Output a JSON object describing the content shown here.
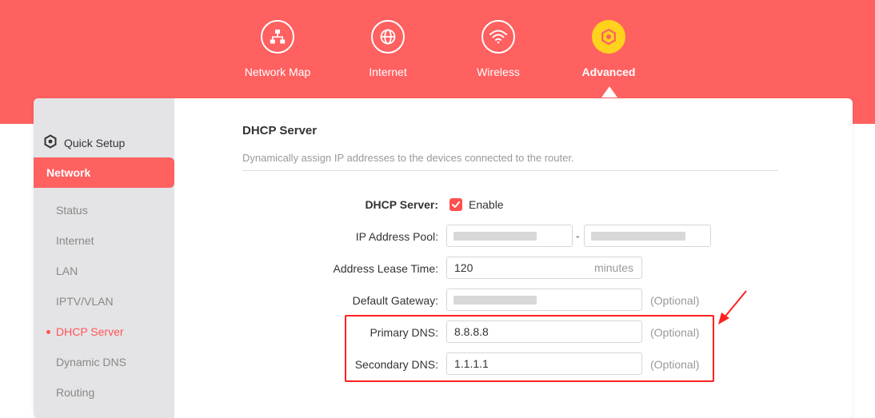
{
  "nav": {
    "items": [
      {
        "label": "Network Map",
        "icon": "network-map-icon"
      },
      {
        "label": "Internet",
        "icon": "globe-icon"
      },
      {
        "label": "Wireless",
        "icon": "wifi-icon"
      },
      {
        "label": "Advanced",
        "icon": "gear-icon",
        "active": true
      }
    ]
  },
  "sidebar": {
    "quick_setup": "Quick Setup",
    "section": "Network",
    "items": [
      {
        "label": "Status"
      },
      {
        "label": "Internet"
      },
      {
        "label": "LAN"
      },
      {
        "label": "IPTV/VLAN"
      },
      {
        "label": "DHCP Server",
        "active": true
      },
      {
        "label": "Dynamic DNS"
      },
      {
        "label": "Routing"
      }
    ]
  },
  "content": {
    "title": "DHCP Server",
    "description": "Dynamically assign IP addresses to the devices connected to the router.",
    "form": {
      "dhcp_label": "DHCP Server:",
      "enable_label": "Enable",
      "enable_checked": true,
      "pool_label": "IP Address Pool:",
      "pool_separator": "-",
      "lease_label": "Address Lease Time:",
      "lease_value": "120",
      "lease_unit": "minutes",
      "gateway_label": "Default Gateway:",
      "primary_dns_label": "Primary DNS:",
      "primary_dns_value": "8.8.8.8",
      "secondary_dns_label": "Secondary DNS:",
      "secondary_dns_value": "1.1.1.1",
      "optional_text": "(Optional)"
    }
  },
  "colors": {
    "brand": "#ff6060",
    "active_icon": "#ffd21e",
    "annotation": "#ff2020"
  }
}
